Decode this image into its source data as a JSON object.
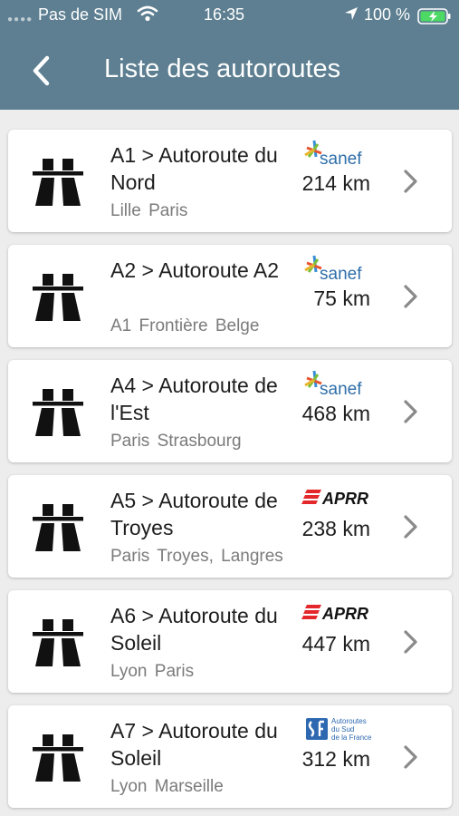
{
  "status_bar": {
    "carrier": "Pas de SIM",
    "time": "16:35",
    "battery": "100 %"
  },
  "header": {
    "title": "Liste des autoroutes"
  },
  "colors": {
    "header": "#5d7f91",
    "background": "#ededed",
    "chevron": "#8a8a8a"
  },
  "highways": [
    {
      "name": "A1 > Autoroute du Nord",
      "route": "Lille Paris",
      "length": "214 km",
      "operator": "sanef",
      "operator_icon": "sanef-logo"
    },
    {
      "name": "A2 > Autoroute A2",
      "route": "A1 Frontière Belge",
      "length": "75 km",
      "operator": "sanef",
      "operator_icon": "sanef-logo"
    },
    {
      "name": "A4 > Autoroute de l'Est",
      "route": "Paris Strasbourg",
      "length": "468 km",
      "operator": "sanef",
      "operator_icon": "sanef-logo"
    },
    {
      "name": "A5 > Autoroute de Troyes",
      "route": "Paris Troyes, Langres",
      "length": "238 km",
      "operator": "APRR",
      "operator_icon": "aprr-logo"
    },
    {
      "name": "A6 > Autoroute du Soleil",
      "route": "Lyon Paris",
      "length": "447 km",
      "operator": "APRR",
      "operator_icon": "aprr-logo"
    },
    {
      "name": "A7 > Autoroute du Soleil",
      "route": "Lyon Marseille",
      "length": "312 km",
      "operator": "Autoroutes du Sud de la France",
      "operator_icon": "asf-logo"
    }
  ]
}
